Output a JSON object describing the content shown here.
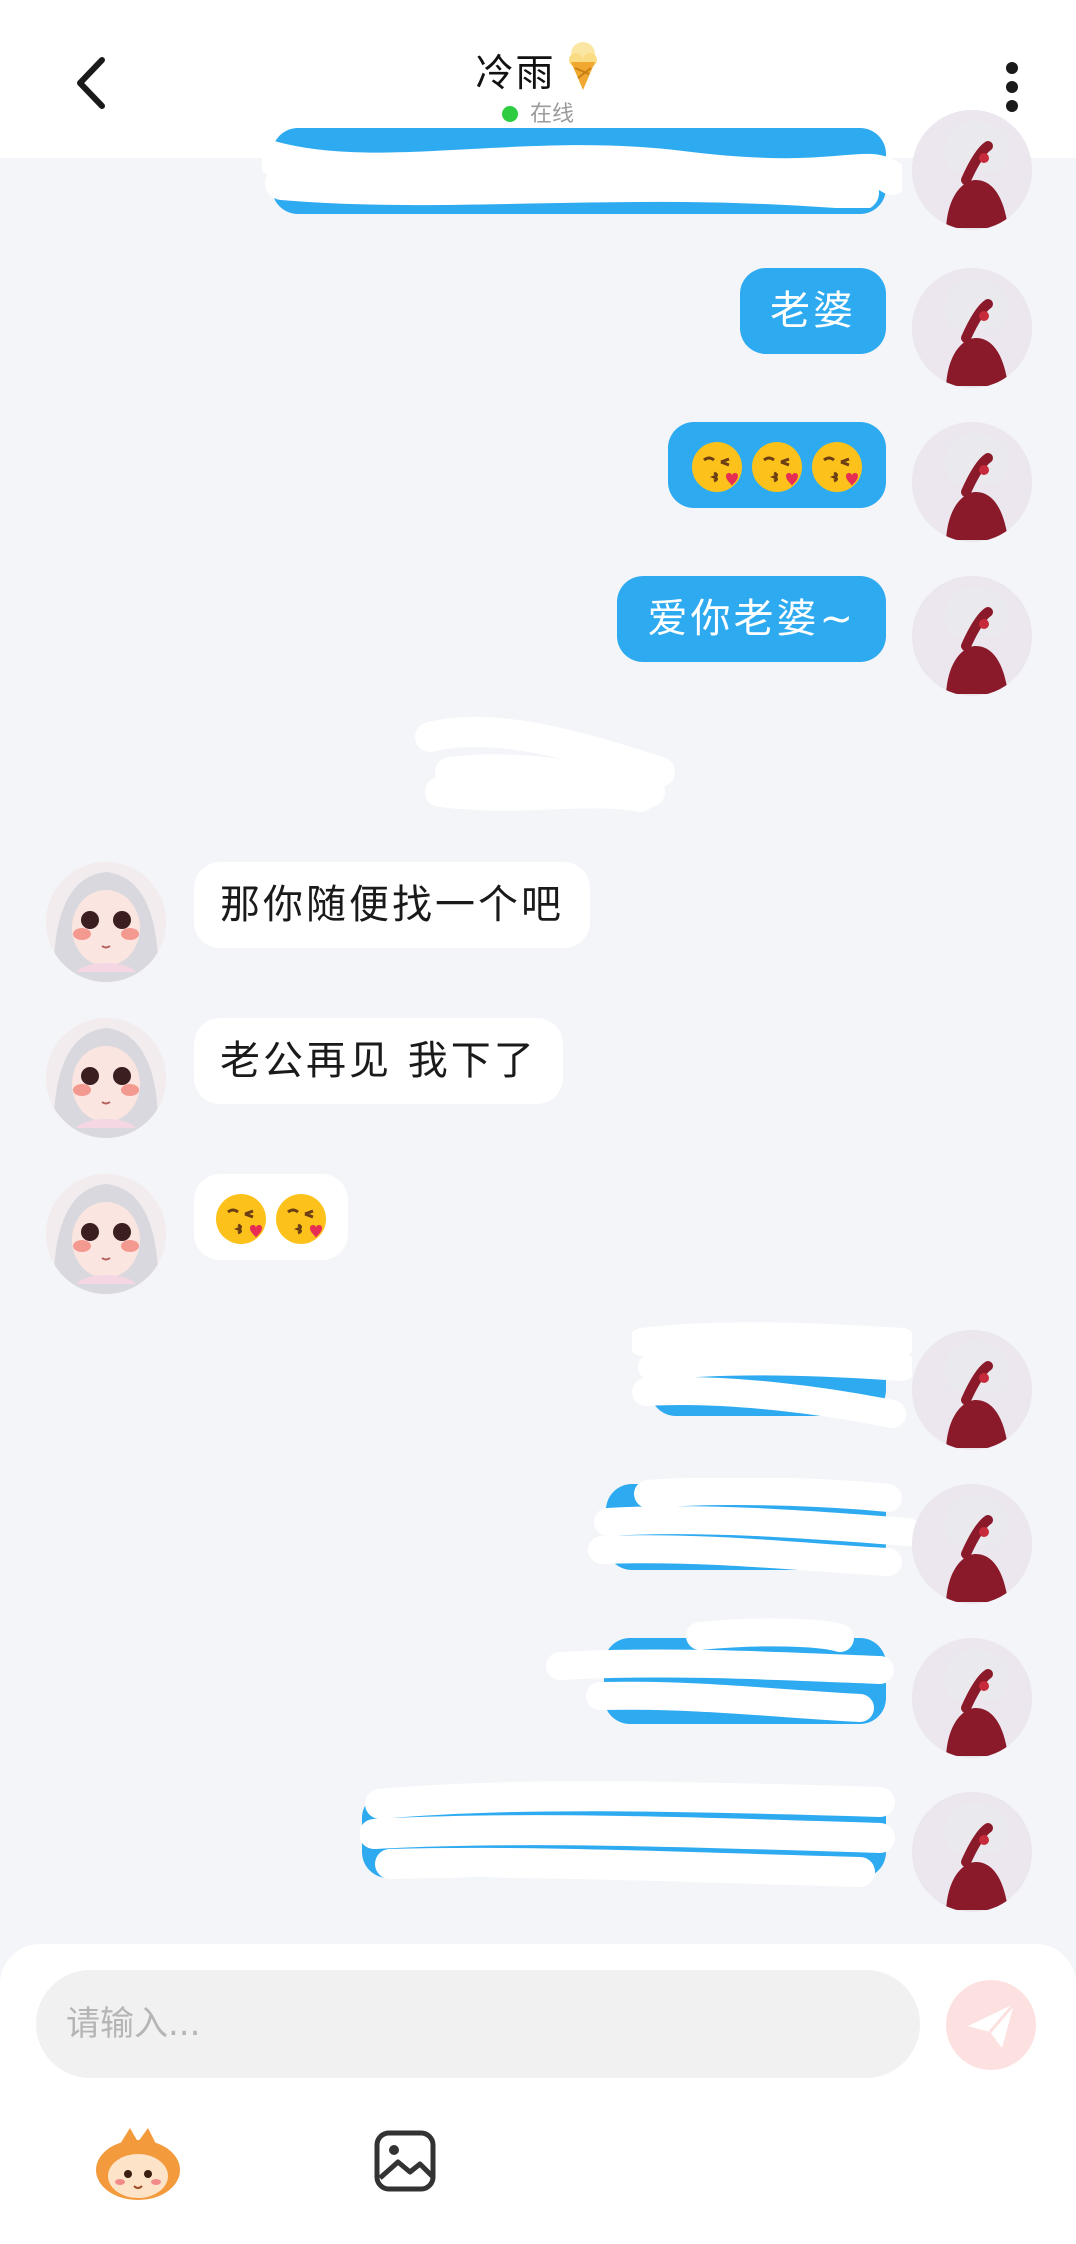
{
  "header": {
    "title": "冷雨",
    "status": "在线"
  },
  "messages": [
    {
      "side": "me",
      "text": "老婆"
    },
    {
      "side": "me",
      "emoji_count": 3,
      "emoji": "kissing-heart"
    },
    {
      "side": "me",
      "text": "爱你老婆~"
    },
    {
      "side": "her",
      "text": "那你随便找一个吧"
    },
    {
      "side": "her",
      "text": "老公再见 我下了"
    },
    {
      "side": "her",
      "emoji_count": 2,
      "emoji": "kissing-heart"
    }
  ],
  "composer": {
    "placeholder": "请输入..."
  },
  "colors": {
    "accent": "#2eaaf0",
    "online": "#2ecc40",
    "send": "#fde1e1"
  }
}
